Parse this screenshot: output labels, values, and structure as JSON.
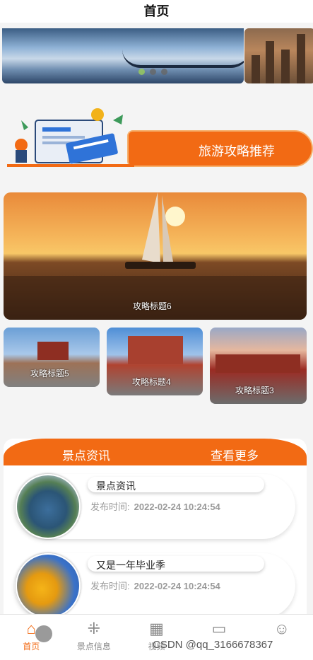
{
  "header": {
    "title": "首页"
  },
  "banner": {
    "dots": 3,
    "active_dot": 0
  },
  "promo": {
    "label": "旅游攻略推荐"
  },
  "guides": [
    {
      "title": "攻略标题6"
    },
    {
      "title": "攻略标题5"
    },
    {
      "title": "攻略标题4"
    },
    {
      "title": "攻略标题3"
    }
  ],
  "news": {
    "title": "景点资讯",
    "more": "查看更多",
    "time_label": "发布时间:",
    "items": [
      {
        "title": "景点资讯",
        "time": "2022-02-24 10:24:54"
      },
      {
        "title": "又是一年毕业季",
        "time": "2022-02-24 10:24:54"
      }
    ]
  },
  "tabbar": {
    "items": [
      {
        "label": "首页",
        "icon": "home-icon"
      },
      {
        "label": "景点信息",
        "icon": "grid-icon"
      },
      {
        "label": "视频",
        "icon": "video-icon"
      },
      {
        "label": "",
        "icon": "chat-icon"
      },
      {
        "label": "",
        "icon": "user-icon"
      }
    ],
    "active": 0
  },
  "watermark": "CSDN @qq_3166678367",
  "colors": {
    "accent": "#f26a14"
  }
}
